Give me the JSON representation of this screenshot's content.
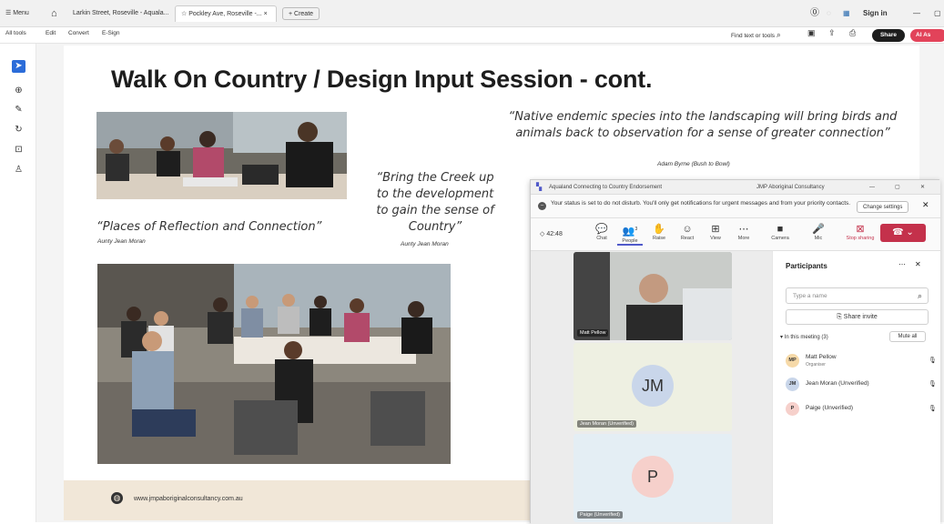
{
  "browser": {
    "menu_label": "Menu",
    "tabs": [
      {
        "label": "Larkin Street, Roseville - Aquala..."
      },
      {
        "label": "Pockley Ave, Roseville -..."
      }
    ],
    "new_tab_label": "+ Create",
    "sign_in_label": "Sign in"
  },
  "toolbar": {
    "items": [
      "All tools",
      "Edit",
      "Convert",
      "E-Sign"
    ],
    "find_label": "Find text or tools",
    "share_label": "Share",
    "ai_label": "AI As"
  },
  "slide": {
    "title": "Walk On Country / Design Input Session - cont.",
    "quote_left": "“Places of Reflection and Connection”",
    "quote_left_author": "Aunty Jean Moran",
    "quote_mid": "“Bring the Creek up to the development to gain the sense of Country”",
    "quote_mid_author": "Aunty Jean Moran",
    "quote_right": "“Native endemic species into the landscaping will bring birds and animals back to observation for a sense of greater connection”",
    "quote_right_author": "Adam Byrne (Bush to Bowl)",
    "footer_url": "www.jmpaboriginalconsultancy.com.au"
  },
  "teams": {
    "window_title": "Aqualand Connecting to Country Endorsement",
    "window_org": "JMP Aboriginal Consultancy",
    "banner": "Your status is set to do not disturb. You'll only get notifications for urgent messages and from your priority contacts.",
    "change_settings": "Change settings",
    "timer": "42:48",
    "toolbar": [
      {
        "icon": "chat-icon",
        "glyph": "💬",
        "label": "Chat"
      },
      {
        "icon": "people-icon",
        "glyph": "👥",
        "label": "People"
      },
      {
        "icon": "raise-hand-icon",
        "glyph": "✋",
        "label": "Raise"
      },
      {
        "icon": "react-icon",
        "glyph": "☺",
        "label": "React"
      },
      {
        "icon": "view-icon",
        "glyph": "⊞",
        "label": "View"
      },
      {
        "icon": "more-icon",
        "glyph": "⋯",
        "label": "More"
      },
      {
        "icon": "camera-icon",
        "glyph": "■",
        "label": "Camera"
      },
      {
        "icon": "mic-icon",
        "glyph": "🎤",
        "label": "Mic"
      },
      {
        "icon": "stop-sharing-icon",
        "glyph": "⊠",
        "label": "Stop sharing"
      }
    ],
    "people_count": "3",
    "tiles": [
      {
        "label": "Matt Pellow"
      },
      {
        "initials": "JM",
        "label": "Jean Moran (Unverified)"
      },
      {
        "initials": "P",
        "label": "Paige (Unverified)"
      }
    ],
    "participants": {
      "title": "Participants",
      "search_placeholder": "Type a name",
      "share_invite": "Share invite",
      "in_meeting": "In this meeting (3)",
      "mute_all": "Mute all",
      "people": [
        {
          "initials": "MP",
          "name": "Matt Pellow",
          "role": "Organiser",
          "color": "#f6d9a8"
        },
        {
          "initials": "JM",
          "name": "Jean Moran (Unverified)",
          "role": "",
          "color": "#c9d6ea"
        },
        {
          "initials": "P",
          "name": "Paige (Unverified)",
          "role": "",
          "color": "#f6d0cb"
        }
      ]
    }
  }
}
